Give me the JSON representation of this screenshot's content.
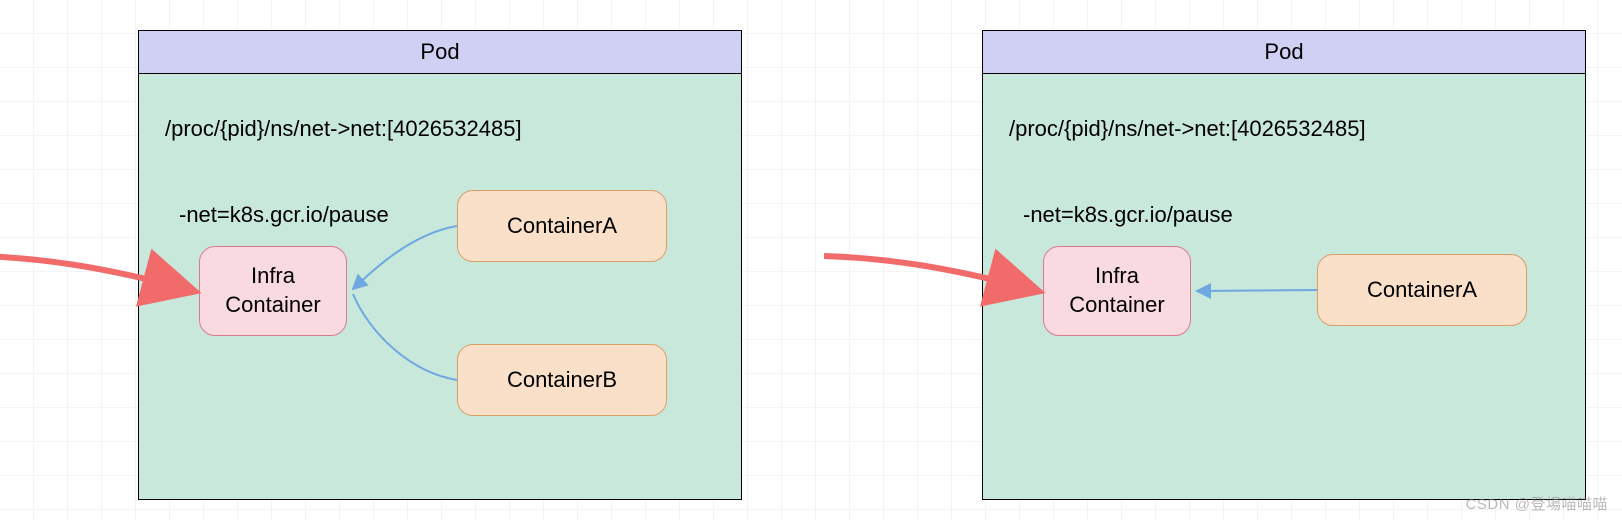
{
  "pods": {
    "left": {
      "title": "Pod",
      "ns_path": "/proc/{pid}/ns/net->net:[4026532485]",
      "net_flag": "-net=k8s.gcr.io/pause",
      "infra": "Infra\nContainer",
      "containerA": "ContainerA",
      "containerB": "ContainerB"
    },
    "right": {
      "title": "Pod",
      "ns_path": "/proc/{pid}/ns/net->net:[4026532485]",
      "net_flag": "-net=k8s.gcr.io/pause",
      "infra": "Infra\nContainer",
      "containerA": "ContainerA"
    }
  },
  "colors": {
    "pod_header": "#d0d0f5",
    "pod_body": "#c9e8dc",
    "infra_fill": "#f9dae0",
    "infra_stroke": "#d97b8c",
    "container_fill": "#fae0c8",
    "container_stroke": "#d9a066",
    "red_arrow": "#f26b6b",
    "blue_arrow": "#6fa8e0"
  },
  "watermark": "CSDN @登場喵喵喵"
}
